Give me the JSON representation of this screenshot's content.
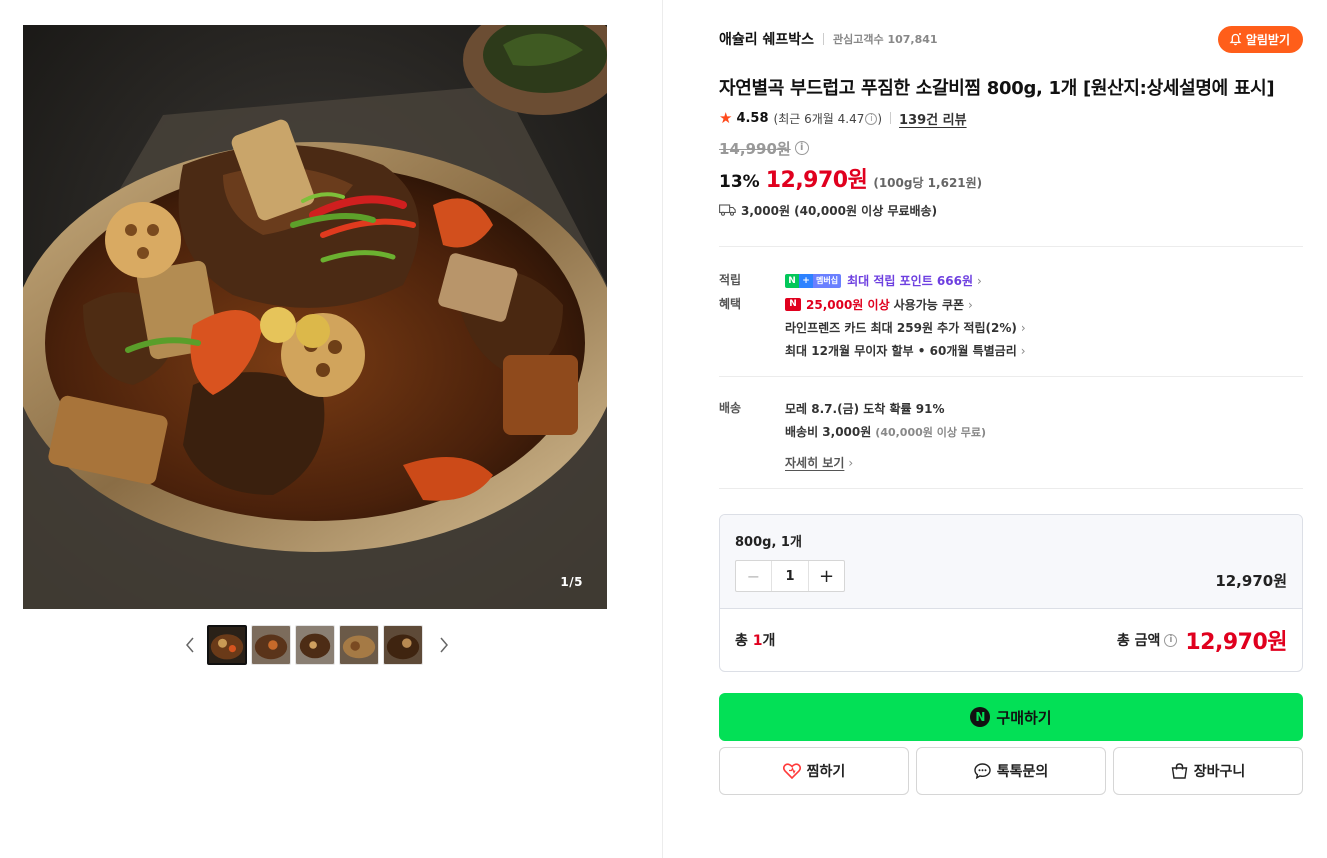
{
  "gallery": {
    "counter": "1/5",
    "prev_icon": "chevron-left-icon",
    "next_icon": "chevron-right-icon",
    "thumbnail_count": 5,
    "active_thumbnail": 1
  },
  "store": {
    "name": "애슐리 쉐프박스",
    "fans": "관심고객수 107,841",
    "notify_label": "알림받기"
  },
  "product": {
    "title": "자연별곡 부드럽고 푸짐한 소갈비찜 800g, 1개 [원산지:상세설명에 표시]",
    "rating": "4.58",
    "rating_recent": "(최근 6개월 4.47",
    "rating_recent_close": ")",
    "review_link": "139건 리뷰",
    "original_price": "14,990원",
    "discount": "13%",
    "sale_price": "12,970원",
    "unit_price": "(100g당 1,621원)",
    "shipping": "3,000원 (40,000원 이상 무료배송)"
  },
  "benefits": {
    "points_label": "적립",
    "points_badge_n": "N",
    "points_badge_plus": "+",
    "points_badge_member": "멤버십",
    "points_text": "최대 적립 포인트 666원",
    "perks_label": "혜택",
    "coupon_badge": "N",
    "coupon_highlight": "25,000원 이상",
    "coupon_text": "사용가능 쿠폰",
    "card_text": "라인프렌즈 카드 최대 259원 추가 적립(2%)",
    "installment_text": "최대 12개월 무이자 할부 • 60개월 특별금리"
  },
  "delivery": {
    "label": "배송",
    "eta": "모레 8.7.(금) 도착 확률 91%",
    "fee": "배송비 3,000원",
    "fee_note": "(40,000원 이상 무료)",
    "detail_link": "자세히 보기"
  },
  "option": {
    "name": "800g, 1개",
    "minus": "−",
    "quantity": "1",
    "plus": "+",
    "price": "12,970원",
    "total_count_prefix": "총 ",
    "total_count_num": "1",
    "total_count_suffix": "개",
    "total_label": "총 금액",
    "total_price": "12,970원"
  },
  "actions": {
    "buy_icon_letter": "N",
    "buy_label": "구매하기",
    "wish_label": "찜하기",
    "talk_label": "톡톡문의",
    "cart_label": "장바구니"
  },
  "colors": {
    "accent_red": "#e0001e",
    "buy_green": "#03e056",
    "notify_orange": "#ff5e1a",
    "points_purple": "#6d3fe0"
  }
}
